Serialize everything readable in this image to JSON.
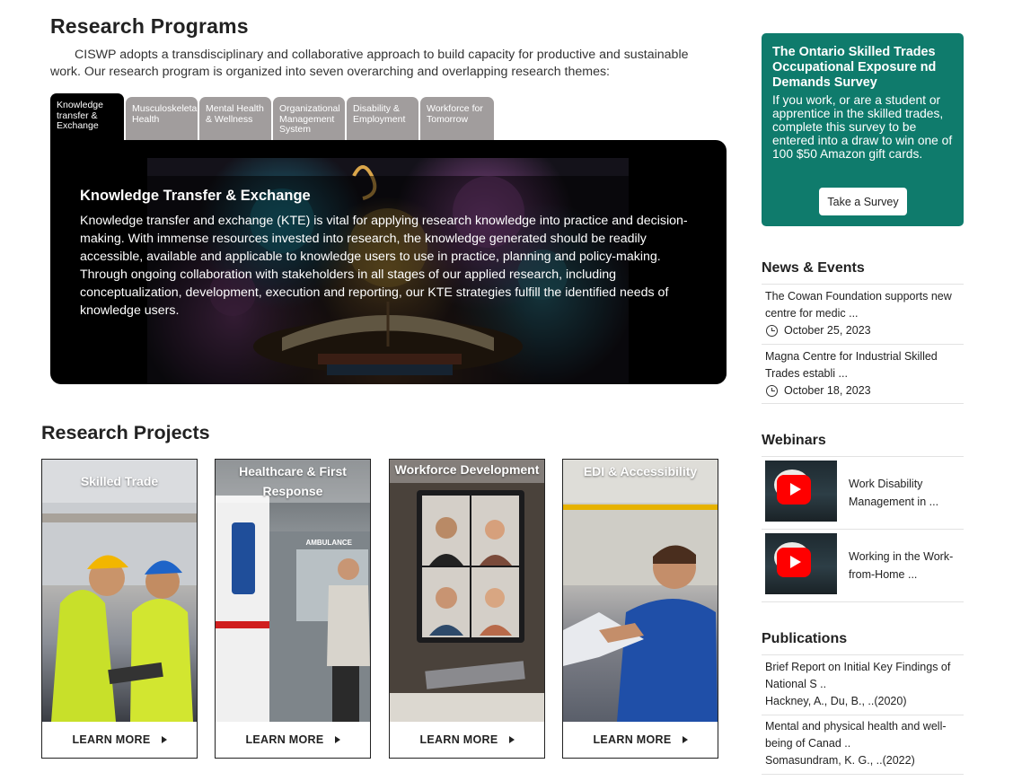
{
  "programs": {
    "title": "Research Programs",
    "intro": "CISWP adopts a transdisciplinary and collaborative approach to build capacity for productive and sustainable work. Our research program is organized into seven overarching and overlapping research themes:",
    "tabs": [
      {
        "label": "Knowledge transfer & Exchange",
        "active": true
      },
      {
        "label": "Musculoskeleta Health",
        "active": false
      },
      {
        "label": "Mental Health & Wellness",
        "active": false
      },
      {
        "label": "Organizational Management System",
        "active": false
      },
      {
        "label": "Disability & Employment",
        "active": false
      },
      {
        "label": "Workforce for Tomorrow",
        "active": false
      }
    ],
    "panel": {
      "heading": "Knowledge Transfer & Exchange",
      "text": "Knowledge transfer and exchange (KTE) is vital for applying research knowledge into practice and decision-making. With immense resources invested into research, the knowledge generated should be readily accessible, available and applicable to knowledge users to use in practice, planning and policy-making. Through ongoing collaboration with stakeholders in all stages of our applied research, including conceptualization, development, execution and reporting, our KTE strategies fulfill the identified needs of knowledge users."
    }
  },
  "projects": {
    "title": "Research Projects",
    "cards": [
      {
        "label": "Skilled Trade",
        "button": "LEARN MORE"
      },
      {
        "label": "Healthcare & First Response",
        "button": "LEARN MORE"
      },
      {
        "label": "Workforce Development",
        "button": "LEARN MORE"
      },
      {
        "label": "EDI & Accessibility",
        "button": "LEARN MORE"
      }
    ],
    "ambulance_sign": "AMBULANCE"
  },
  "survey": {
    "title": "The Ontario Skilled Trades Occupational Exposure nd Demands Survey",
    "text": "If you work, or are a student or apprentice in the skilled trades, complete this survey to be entered into a draw to win one of 100 $50 Amazon gift cards.",
    "button": "Take a Survey",
    "bg_color": "#0f7b6c"
  },
  "news": {
    "title": "News & Events",
    "items": [
      {
        "text": "The Cowan Foundation supports new centre for medic ...",
        "date": "October 25, 2023"
      },
      {
        "text": "Magna Centre for Industrial Skilled Trades establi ...",
        "date": "October 18, 2023"
      }
    ]
  },
  "webinars": {
    "title": "Webinars",
    "items": [
      {
        "text": "Work Disability Management in ..."
      },
      {
        "text": "Working in the Work-from-Home ..."
      }
    ]
  },
  "publications": {
    "title": "Publications",
    "items": [
      {
        "text": "Brief Report on Initial Key Findings of National S ..",
        "authors": "Hackney, A., Du, B., ..(2020)"
      },
      {
        "text": "Mental and physical health and well-being of Canad ..",
        "authors": "Somasundram, K. G., ..(2022)"
      }
    ]
  }
}
